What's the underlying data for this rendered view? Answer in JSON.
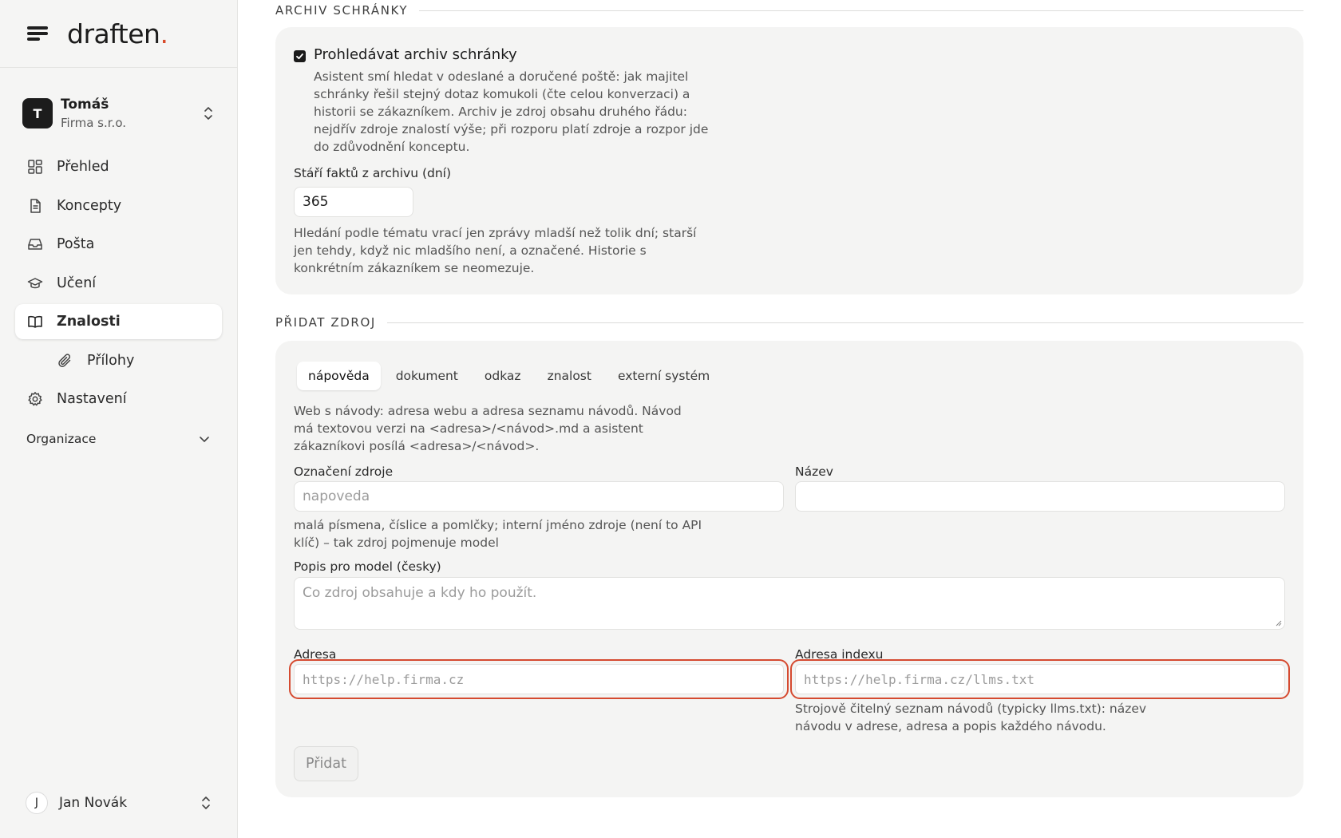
{
  "brand": {
    "name": "draften",
    "dot": "."
  },
  "account": {
    "initial": "T",
    "name": "Tomáš",
    "org": "Firma s.r.o."
  },
  "nav": {
    "items": [
      {
        "label": "Přehled",
        "icon": "dashboard-icon"
      },
      {
        "label": "Koncepty",
        "icon": "document-icon"
      },
      {
        "label": "Pošta",
        "icon": "inbox-icon"
      },
      {
        "label": "Učení",
        "icon": "graduation-cap-icon"
      },
      {
        "label": "Znalosti",
        "icon": "book-icon"
      },
      {
        "label": "Přílohy",
        "icon": "paperclip-icon"
      },
      {
        "label": "Nastavení",
        "icon": "gear-icon"
      }
    ],
    "organization_label": "Organizace"
  },
  "user": {
    "initial": "J",
    "name": "Jan Novák"
  },
  "archive": {
    "section_title": "ARCHIV SCHRÁNKY",
    "checkbox_label": "Prohledávat archiv schránky",
    "checkbox_checked": true,
    "checkbox_desc": "Asistent smí hledat v odeslané a doručené poště: jak majitel schránky řešil stejný dotaz komukoli (čte celou konverzaci) a historii se zákazníkem. Archiv je zdroj obsahu druhého řádu: nejdřív zdroje znalostí výše; při rozporu platí zdroje a rozpor jde do zdůvodnění konceptu.",
    "age_label": "Stáří faktů z archivu (dní)",
    "age_value": "365",
    "age_desc": "Hledání podle tématu vrací jen zprávy mladší než tolik dní; starší jen tehdy, když nic mladšího není, a označené. Historie s konkrétním zákazníkem se neomezuje."
  },
  "add_source": {
    "section_title": "PŘIDAT ZDROJ",
    "tabs": [
      "nápověda",
      "dokument",
      "odkaz",
      "znalost",
      "externí systém"
    ],
    "active_tab": "nápověda",
    "intro": "Web s návody: adresa webu a adresa seznamu návodů. Návod má textovou verzi na <adresa>/<návod>.md a asistent zákazníkovi posílá <adresa>/<návod>.",
    "source_id_label": "Označení zdroje",
    "source_id_placeholder": "napoveda",
    "source_id_help": "malá písmena, číslice a pomlčky; interní jméno zdroje (není to API klíč) – tak zdroj pojmenuje model",
    "name_label": "Název",
    "name_value": "",
    "description_label": "Popis pro model (česky)",
    "description_placeholder": "Co zdroj obsahuje a kdy ho použít.",
    "address_label": "Adresa",
    "address_placeholder": "https://help.firma.cz",
    "index_label": "Adresa indexu",
    "index_placeholder": "https://help.firma.cz/llms.txt",
    "index_help": "Strojově čitelný seznam návodů (typicky llms.txt): název návodu v adrese, adresa a popis každého návodu.",
    "submit_label": "Přidat"
  },
  "colors": {
    "accent_dot": "#d84a2a",
    "highlight": "#d54a30",
    "sidebar_bg": "#f5f5f4",
    "card_bg": "#f4f4f3"
  }
}
